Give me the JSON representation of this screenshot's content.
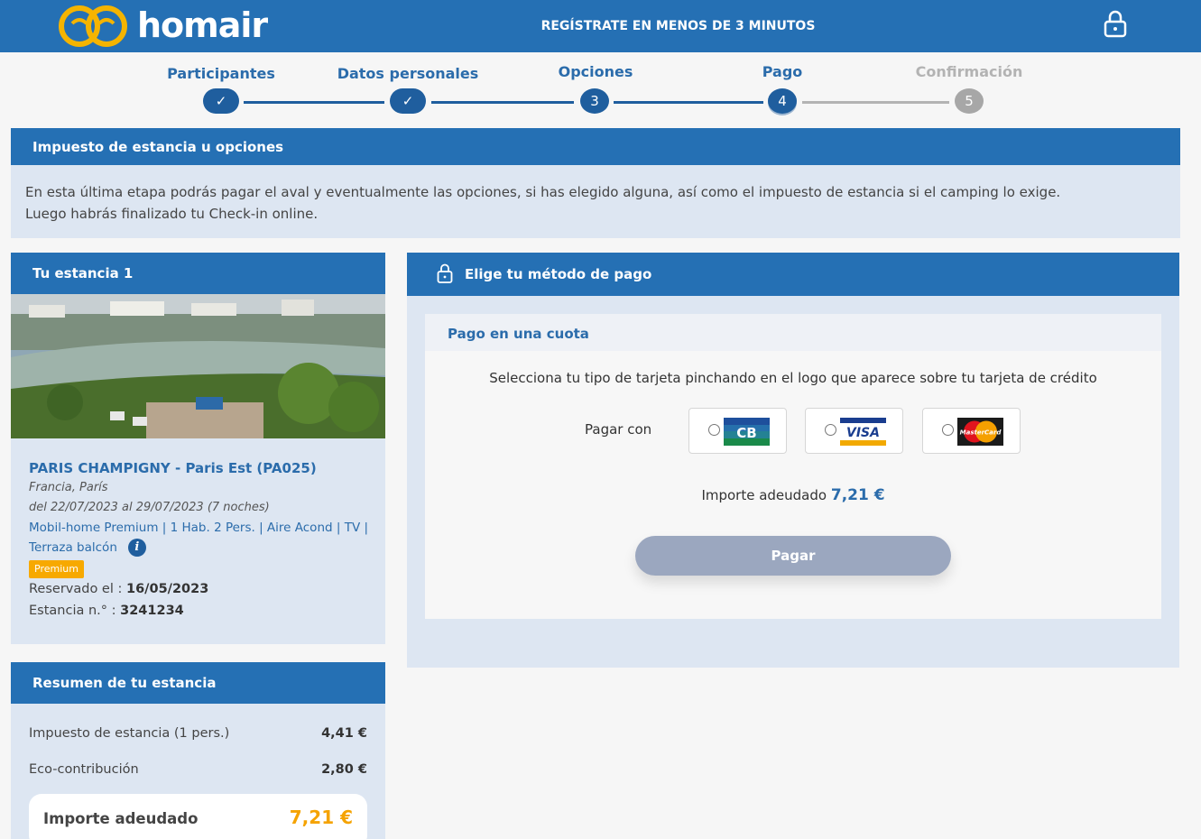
{
  "header": {
    "brand": "homair",
    "tagline": "REGÍSTRATE EN MENOS DE 3 MINUTOS",
    "brand_color": "#2570b4"
  },
  "stepper": {
    "steps": [
      {
        "label": "Participantes",
        "state": "done",
        "number": ""
      },
      {
        "label": "Datos personales",
        "state": "done",
        "number": ""
      },
      {
        "label": "Opciones",
        "state": "current",
        "number": "3"
      },
      {
        "label": "Pago",
        "state": "active",
        "number": "4"
      },
      {
        "label": "Confirmación",
        "state": "pending",
        "number": "5"
      }
    ],
    "check_glyph": "✓"
  },
  "banner": {
    "title": "Impuesto de estancia u opciones",
    "line1": "En esta última etapa podrás pagar el aval y eventualmente las opciones, si has elegido alguna, así como el impuesto de estancia si el camping lo exige.",
    "line2": "Luego habrás finalizado tu Check-in online."
  },
  "stay": {
    "title": "Tu estancia 1",
    "camp_name": "PARIS CHAMPIGNY - Paris Est (PA025)",
    "location": "Francia, París",
    "dates": "del 22/07/2023 al 29/07/2023 (7 noches)",
    "unit": "Mobil-home Premium | 1 Hab. 2 Pers. | Aire Acond | TV | Terraza balcón",
    "info_glyph": "i",
    "badge": "Premium",
    "badge_color": "#f7a900",
    "reserved_label": "Reservado el : ",
    "reserved_date": "16/05/2023",
    "stay_no_label": "Estancia n.° : ",
    "stay_no": "3241234"
  },
  "summary": {
    "title": "Resumen de tu estancia",
    "rows": [
      {
        "label": "Impuesto de estancia (1 pers.)",
        "amount": "4,41 €"
      },
      {
        "label": "Eco-contribución",
        "amount": "2,80 €"
      }
    ],
    "total_label": "Importe adeudado",
    "total_amount": "7,21 €",
    "total_color": "#f5a300"
  },
  "payment": {
    "title": "Elige tu método de pago",
    "subtitle": "Pago en una cuota",
    "instruction": "Selecciona tu tipo de tarjeta pinchando en el logo que aparece sobre tu tarjeta de crédito",
    "pay_with": "Pagar con",
    "cards": [
      {
        "name": "cb-card",
        "text": "CB"
      },
      {
        "name": "visa-card",
        "text": "VISA"
      },
      {
        "name": "mastercard-card",
        "text": "MasterCard"
      }
    ],
    "due_label": "Importe adeudado ",
    "due_amount": "7,21 €",
    "pay_button": "Pagar"
  }
}
